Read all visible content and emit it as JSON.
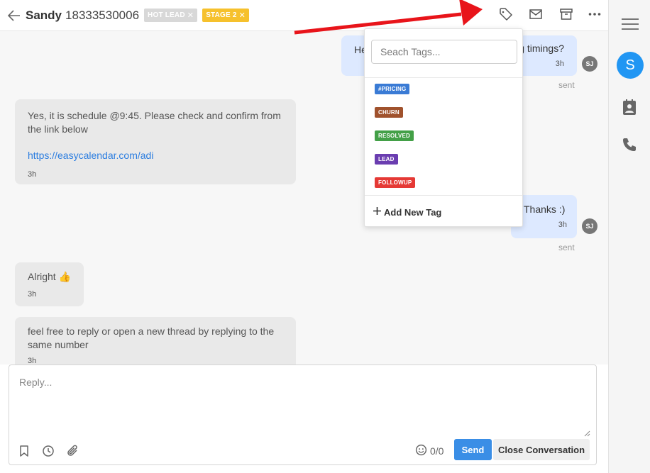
{
  "header": {
    "contact_name": "Sandy",
    "phone": "18333530006",
    "chips": [
      {
        "label": "HOT LEAD",
        "color": "#d8d8d8"
      },
      {
        "label": "STAGE 2",
        "color": "#f6c12d"
      }
    ],
    "icons": [
      "tag-icon",
      "mail-icon",
      "archive-icon",
      "more-icon"
    ]
  },
  "messages": {
    "out1": {
      "text_start": "He",
      "text_end": "g timings?",
      "time": "3h",
      "avatar": "SJ",
      "status": "sent"
    },
    "in1": {
      "text": "Yes, it is schedule @9:45. Please check and confirm from the link below",
      "link": "https://easycalendar.com/adi",
      "time": "3h"
    },
    "out2": {
      "text": "Thanks :)",
      "time": "3h",
      "avatar": "SJ",
      "status": "sent"
    },
    "in2": {
      "text": "Alright 👍",
      "time": "3h"
    },
    "in3": {
      "text": "feel free to reply or open a new thread by replying to the same number",
      "time": "3h"
    }
  },
  "tag_dropdown": {
    "search_placeholder": "Seach Tags...",
    "tags": [
      {
        "label": "#PRICING",
        "color": "#3a7bd5"
      },
      {
        "label": "CHURN",
        "color": "#a0522d"
      },
      {
        "label": "RESOLVED",
        "color": "#43a047"
      },
      {
        "label": "LEAD",
        "color": "#6a3db0"
      },
      {
        "label": "FOLLOWUP",
        "color": "#e53935"
      }
    ],
    "add_new_label": "Add New Tag"
  },
  "reply": {
    "placeholder": "Reply...",
    "counter": "0/0",
    "send_label": "Send",
    "close_label": "Close Conversation"
  },
  "sidebar": {
    "avatar_letter": "S",
    "avatar_color": "#2196f3"
  },
  "annotation": {
    "arrow_color": "#e8141a"
  }
}
